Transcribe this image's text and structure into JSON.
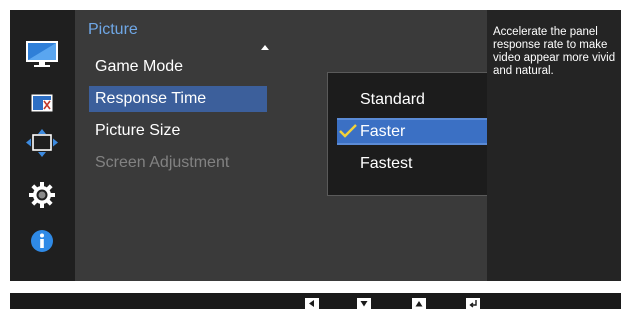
{
  "sidebar": {
    "icons": [
      "monitor-icon",
      "color-icon",
      "size-position-icon",
      "gear-icon",
      "info-icon"
    ]
  },
  "main": {
    "title": "Picture",
    "items": [
      {
        "label": "Game Mode",
        "state": "normal"
      },
      {
        "label": "Response Time",
        "state": "selected"
      },
      {
        "label": "Picture Size",
        "state": "normal"
      },
      {
        "label": "Screen Adjustment",
        "state": "disabled"
      }
    ]
  },
  "dropdown": {
    "options": [
      {
        "label": "Standard",
        "checked": false
      },
      {
        "label": "Faster",
        "checked": true
      },
      {
        "label": "Fastest",
        "checked": false
      }
    ]
  },
  "help": {
    "text": "Accelerate the panel response rate to make video appear more vivid and natural."
  },
  "colors": {
    "accent_title": "#6fa7e6",
    "selected_item": "#3c5f9b",
    "selected_option": "#3b70c4",
    "check": "#f2d23a"
  },
  "nav_buttons": [
    "left-arrow-icon",
    "down-arrow-icon",
    "up-arrow-icon",
    "enter-icon"
  ]
}
